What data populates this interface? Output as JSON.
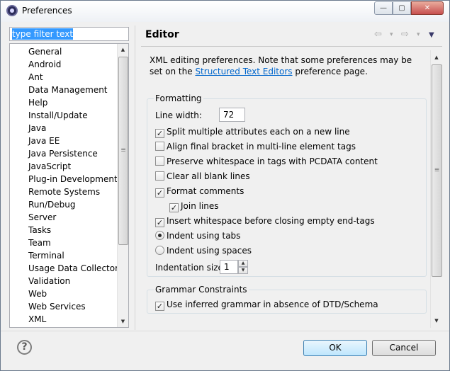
{
  "window": {
    "title": "Preferences"
  },
  "window_buttons": {
    "minimize": "—",
    "maximize": "▢",
    "close": "✕"
  },
  "filter": {
    "text": "type filter text"
  },
  "tree": {
    "items": [
      "General",
      "Android",
      "Ant",
      "Data Management",
      "Help",
      "Install/Update",
      "Java",
      "Java EE",
      "Java Persistence",
      "JavaScript",
      "Plug-in Development",
      "Remote Systems",
      "Run/Debug",
      "Server",
      "Tasks",
      "Team",
      "Terminal",
      "Usage Data Collector",
      "Validation",
      "Web",
      "Web Services",
      "XML"
    ]
  },
  "page": {
    "title": "Editor",
    "nav": {
      "back": "⇦",
      "forward": "⇨",
      "dropdown": "▾",
      "menu": "▼"
    }
  },
  "intro": {
    "text_before": "XML editing preferences.  Note that some preferences may be set on the ",
    "link": "Structured Text Editors",
    "text_after": " preference page."
  },
  "formatting": {
    "label": "Formatting",
    "line_width_label": "Line width:",
    "line_width_value": "72",
    "options": {
      "split_attributes": {
        "label": "Split multiple attributes each on a new line",
        "checked": true
      },
      "align_bracket": {
        "label": "Align final bracket in multi-line element tags",
        "checked": false
      },
      "preserve_whitespace": {
        "label": "Preserve whitespace in tags with PCDATA content",
        "checked": false
      },
      "clear_blank": {
        "label": "Clear all blank lines",
        "checked": false
      },
      "format_comments": {
        "label": "Format comments",
        "checked": true
      },
      "join_lines": {
        "label": "Join lines",
        "checked": true
      },
      "insert_whitespace": {
        "label": "Insert whitespace before closing empty end-tags",
        "checked": true
      }
    },
    "indent_tabs": {
      "label": "Indent using tabs",
      "selected": true
    },
    "indent_spaces": {
      "label": "Indent using spaces",
      "selected": false
    },
    "indentation_size_label": "Indentation size:",
    "indentation_size_value": "1"
  },
  "grammar": {
    "label": "Grammar Constraints",
    "use_inferred": {
      "label": "Use inferred grammar in absence of DTD/Schema",
      "checked": true
    }
  },
  "buttons": {
    "help": "?",
    "ok": "OK",
    "cancel": "Cancel"
  },
  "glyphs": {
    "check": "✓",
    "up": "▲",
    "down": "▼",
    "grip": "≡"
  }
}
